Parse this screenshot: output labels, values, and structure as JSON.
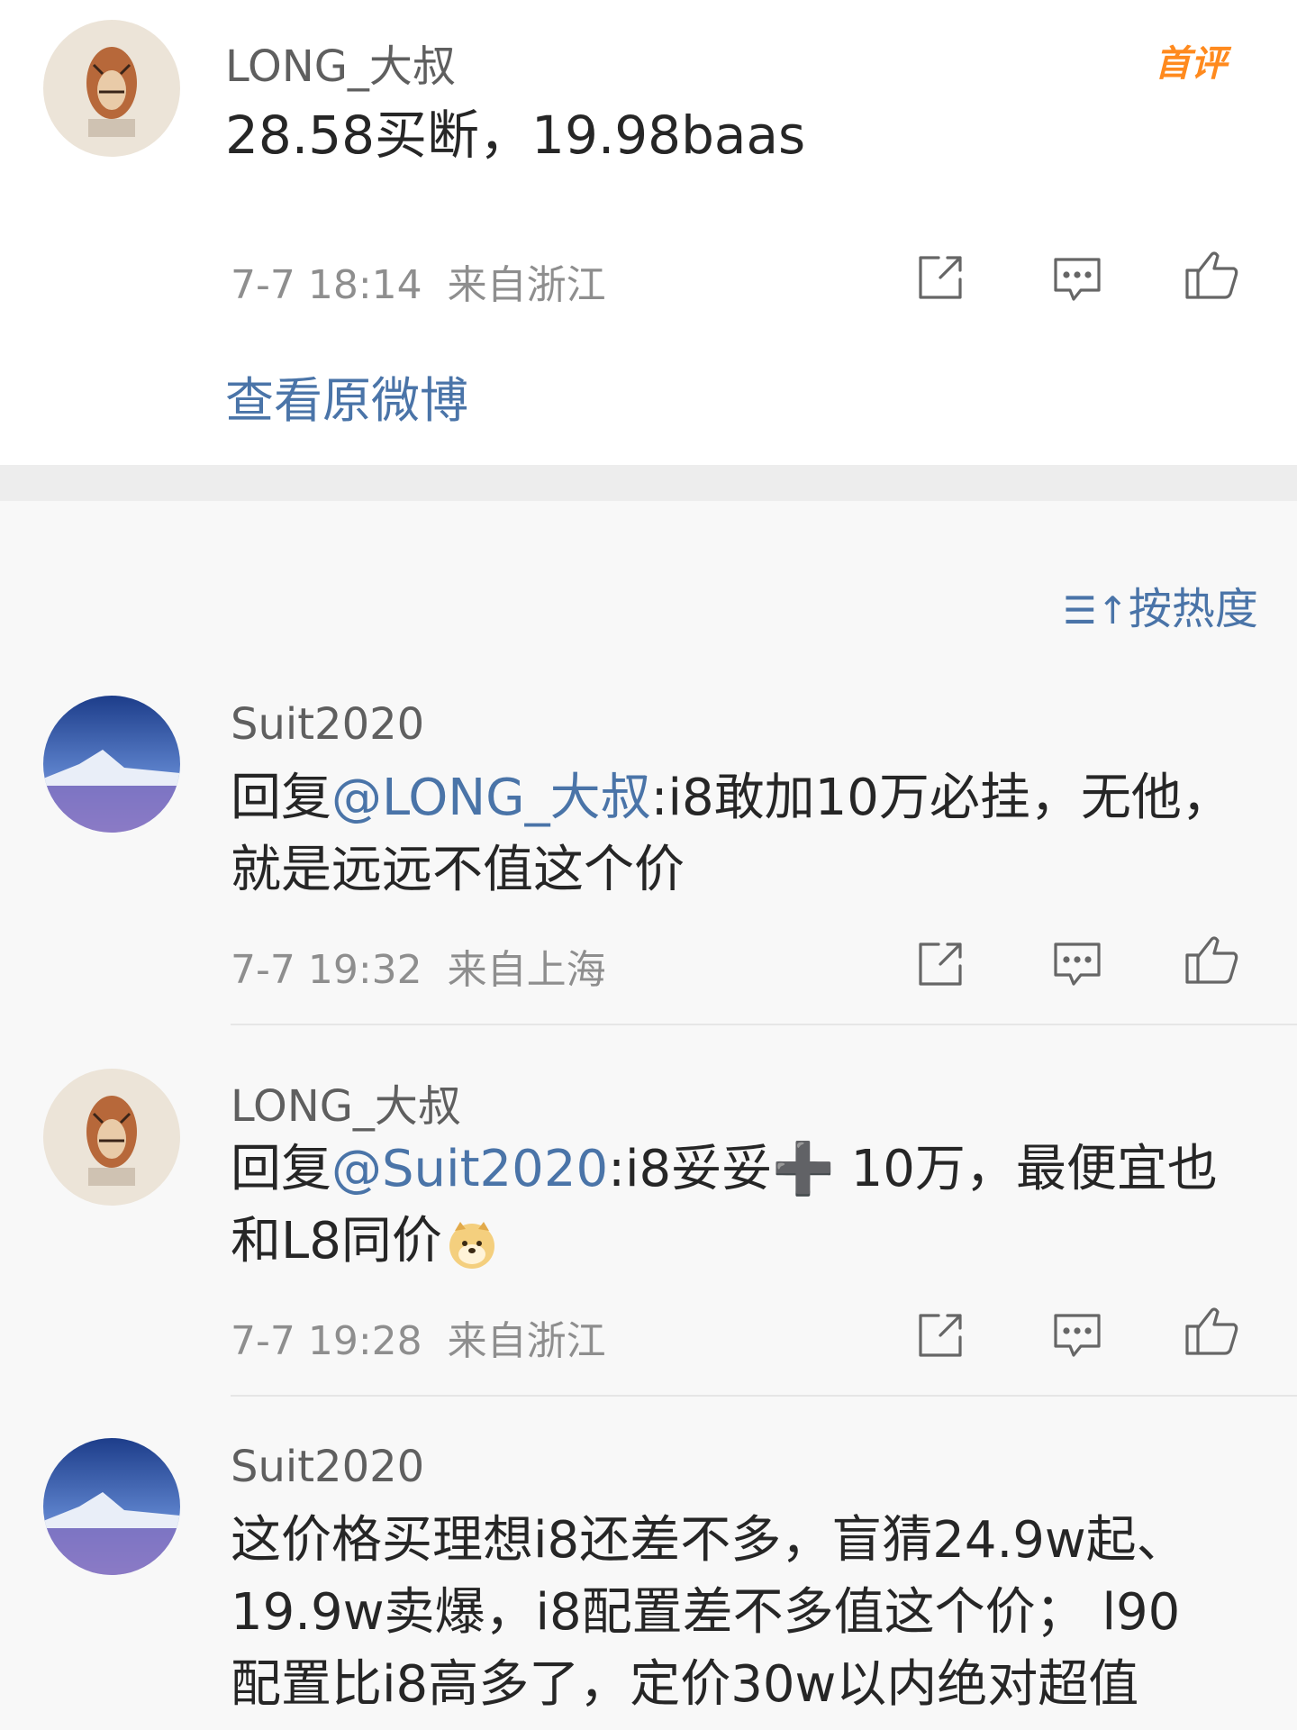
{
  "original": {
    "author": "LONG_大叔",
    "badge": "首评",
    "content": "28.58买断，19.98baas",
    "time": "7-7 18:14",
    "location": "来自浙江",
    "view_original": "查看原微博"
  },
  "sort": {
    "label": "按热度"
  },
  "replies": [
    {
      "author": "Suit2020",
      "prefix": "回复",
      "mention": "@LONG_大叔",
      "line1": ":i8敢加10万必挂，无他，",
      "line2": "就是远远不值这个价",
      "time": "7-7 19:32",
      "location": "来自上海"
    },
    {
      "author": "LONG_大叔",
      "prefix": "回复",
      "mention": "@Suit2020",
      "line1": ":i8妥妥➕ 10万，最便宜也",
      "line2": "和L8同价",
      "time": "7-7 19:28",
      "location": "来自浙江"
    },
    {
      "author": "Suit2020",
      "line1": "这价格买理想i8还差不多，盲猜24.9w起、",
      "line2": "19.9w卖爆，i8配置差不多值这个价； l90",
      "line3": "配置比i8高多了，定价30w以内绝对超值"
    }
  ]
}
